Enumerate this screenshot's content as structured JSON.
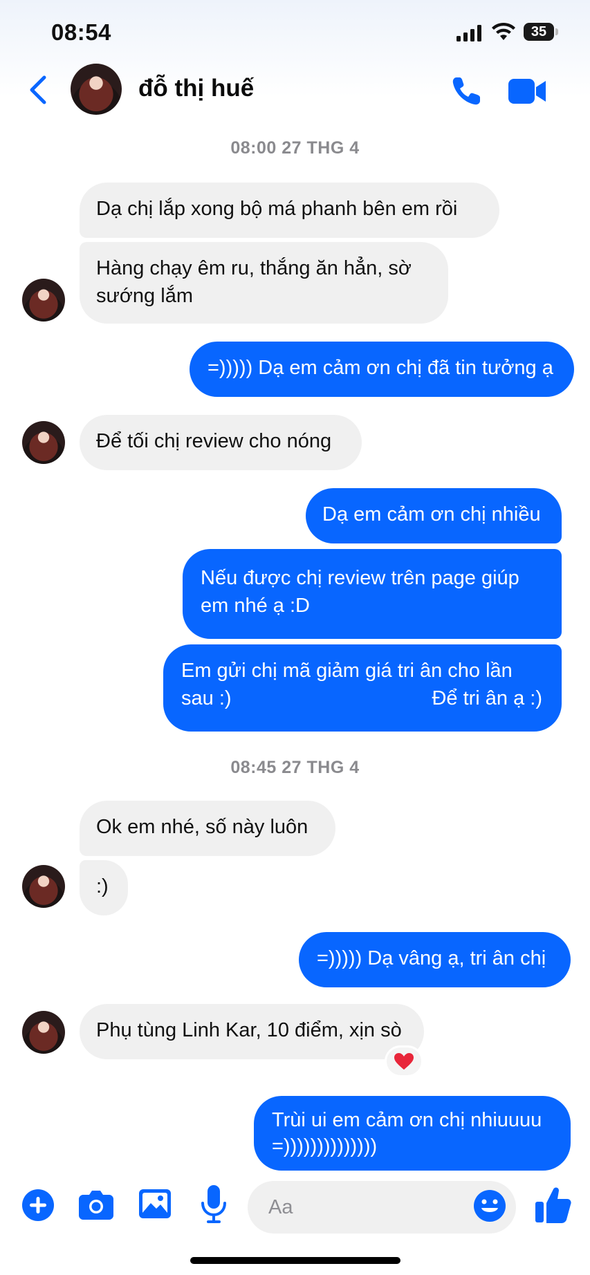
{
  "status_bar": {
    "time": "08:54",
    "battery": "35"
  },
  "header": {
    "contact_name": "đỗ thị huế"
  },
  "timestamps": [
    "08:00 27 THG 4",
    "08:45 27 THG 4"
  ],
  "messages": [
    {
      "dir": "in",
      "text": "Dạ chị lắp xong bộ má phanh bên em rồi"
    },
    {
      "dir": "in",
      "text": "Hàng chạy êm ru, thắng ăn hẳn, sờ\nsướng lắm"
    },
    {
      "dir": "out",
      "text": "=))))) Dạ em cảm ơn chị đã tin tưởng ạ"
    },
    {
      "dir": "in",
      "text": "Để tối chị review cho nóng"
    },
    {
      "dir": "out",
      "text": "Dạ em cảm ơn chị nhiều"
    },
    {
      "dir": "out",
      "text": "Nếu được chị review trên page giúp\nem nhé ạ :D"
    },
    {
      "dir": "out",
      "text": "Em gửi chị mã giảm giá tri ân cho lần\nsau :)",
      "text_right": "Để tri ân ạ :)"
    },
    {
      "dir": "in",
      "text": "Ok em nhé, số này luôn"
    },
    {
      "dir": "in",
      "text": ":)"
    },
    {
      "dir": "out",
      "text": "=))))) Dạ vâng ạ, tri ân chị"
    },
    {
      "dir": "in",
      "text": "Phụ tùng Linh Kar, 10 điểm, xịn sò",
      "reaction": "red-heart"
    },
    {
      "dir": "out",
      "text": "Trùi ui em cảm ơn chị nhiuuuu\n=))))))))))))))"
    }
  ],
  "composer": {
    "placeholder": "Aa"
  },
  "colors": {
    "accent": "#0866ff",
    "incoming_bubble": "#f0f0f0",
    "outgoing_bubble": "#0866ff",
    "reaction_heart": "#e8263a"
  }
}
